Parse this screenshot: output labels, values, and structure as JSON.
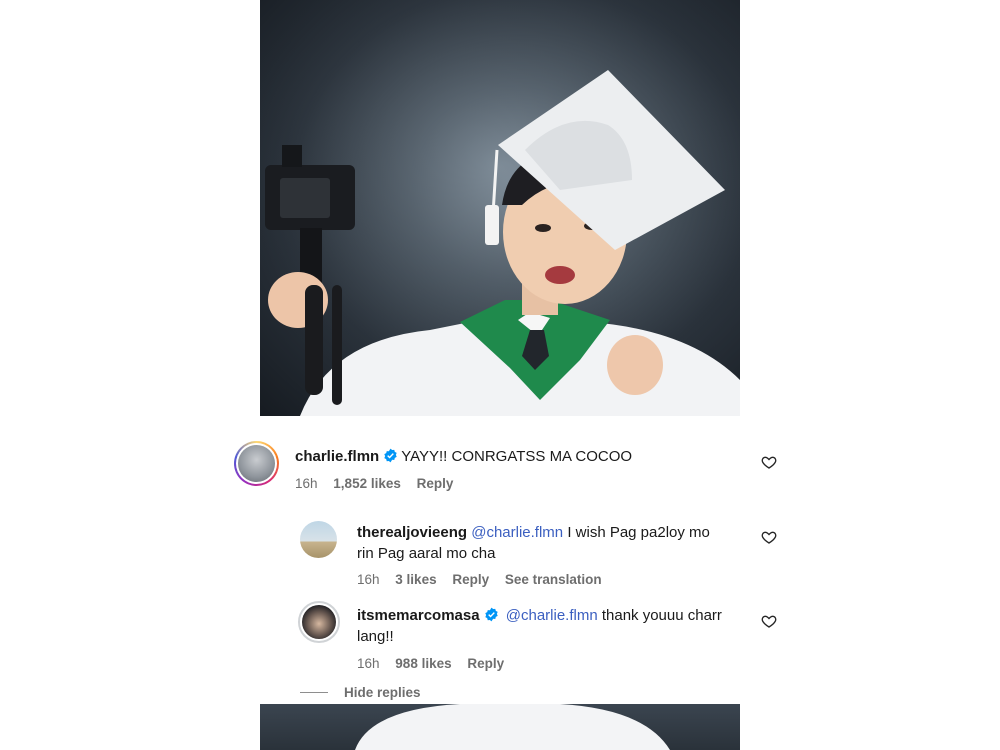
{
  "comments": [
    {
      "username": "charlie.flmn",
      "verified": true,
      "text": "YAYY!! CONRGATSS MA COCOO",
      "time": "16h",
      "likes": "1,852 likes",
      "reply": "Reply"
    }
  ],
  "replies": [
    {
      "username": "therealjovieeng",
      "mention": "@charlie.flmn",
      "text_line1": "I wish Pag pa2loy mo",
      "text_line2": "rin Pag aaral mo cha",
      "time": "16h",
      "likes": "3 likes",
      "reply": "Reply",
      "translate": "See translation"
    },
    {
      "username": "itsmemarcomasa",
      "verified": true,
      "mention": "@charlie.flmn",
      "text_line1": "thank youuu charr",
      "text_line2": "lang!!",
      "time": "16h",
      "likes": "988 likes",
      "reply": "Reply"
    }
  ],
  "hide_replies": "Hide replies",
  "colors": {
    "mention": "#3b5fc0",
    "verified": "#0095f6",
    "gown_green": "#1f8a4c"
  },
  "icons": [
    "heart-icon",
    "verified-badge-icon"
  ]
}
